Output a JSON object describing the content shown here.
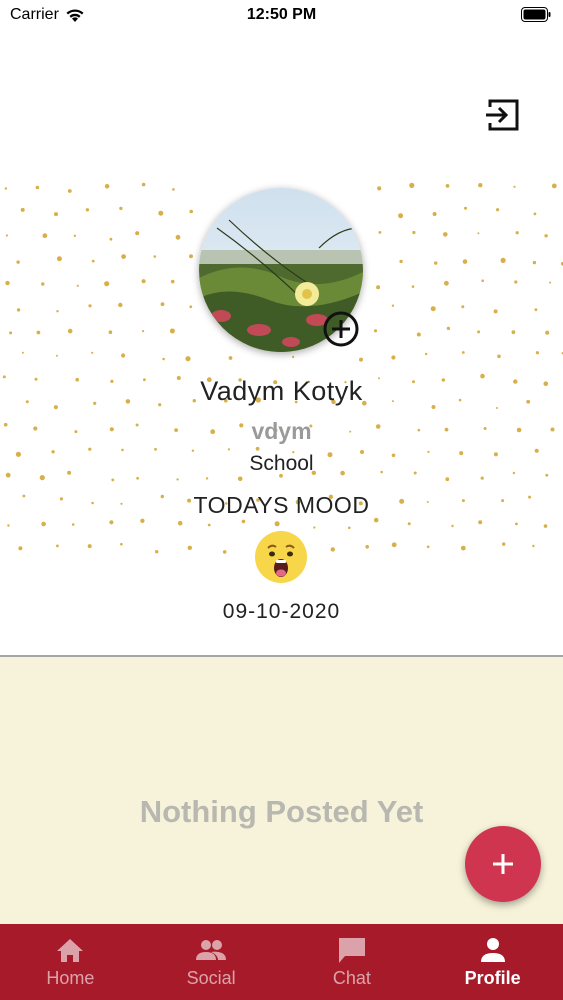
{
  "status_bar": {
    "carrier": "Carrier",
    "time": "12:50 PM"
  },
  "header": {
    "logout_icon": "logout-icon"
  },
  "profile": {
    "name": "Vadym Kotyk",
    "username": "vdym",
    "school": "School",
    "mood_label": "TODAYS MOOD",
    "mood_icon": "surprised-face-emoji",
    "mood_date": "09-10-2020",
    "add_photo_icon": "add-circle-icon"
  },
  "posts": {
    "empty_message": "Nothing Posted Yet"
  },
  "fab": {
    "icon": "plus-icon",
    "color": "#d0354f"
  },
  "bottom_nav": {
    "background": "#a61a29",
    "items": [
      {
        "label": "Home",
        "icon": "home-icon",
        "active": false
      },
      {
        "label": "Social",
        "icon": "people-icon",
        "active": false
      },
      {
        "label": "Chat",
        "icon": "chat-icon",
        "active": false
      },
      {
        "label": "Profile",
        "icon": "person-icon",
        "active": true
      }
    ]
  },
  "colors": {
    "accent_dots": "#d8b04a",
    "posts_background": "#f6f3da"
  }
}
